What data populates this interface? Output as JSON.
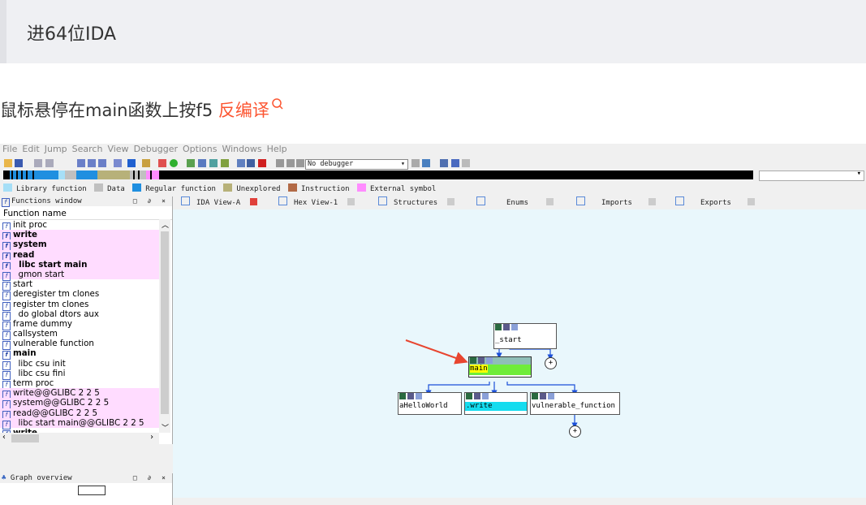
{
  "quote": {
    "text": "进64位IDA"
  },
  "instruction": {
    "text": "鼠标悬停在main函数上按f5 ",
    "link": "反编译"
  },
  "ida": {
    "menu": [
      "File",
      "Edit",
      "Jump",
      "Search",
      "View",
      "Debugger",
      "Options",
      "Windows",
      "Help"
    ],
    "debugger": "No debugger",
    "legend": [
      {
        "label": "Library function",
        "color": "#a6dff7"
      },
      {
        "label": "Data",
        "color": "#c0c0c0"
      },
      {
        "label": "Regular function",
        "color": "#1f8fe0"
      },
      {
        "label": "Unexplored",
        "color": "#b7b179"
      },
      {
        "label": "Instruction",
        "color": "#b26a46"
      },
      {
        "label": "External symbol",
        "color": "#ff8cff"
      }
    ],
    "functions_window": {
      "title": "Functions window",
      "header": "Function name",
      "rows": [
        {
          "name": "init proc",
          "pink": false,
          "bold": false
        },
        {
          "name": "write",
          "pink": true,
          "bold": true
        },
        {
          "name": "system",
          "pink": true,
          "bold": true
        },
        {
          "name": "read",
          "pink": true,
          "bold": true
        },
        {
          "name": "  libc start main",
          "pink": true,
          "bold": true
        },
        {
          "name": "  gmon start",
          "pink": true,
          "bold": false
        },
        {
          "name": "start",
          "pink": false,
          "bold": false
        },
        {
          "name": "deregister tm clones",
          "pink": false,
          "bold": false
        },
        {
          "name": "register tm clones",
          "pink": false,
          "bold": false
        },
        {
          "name": "  do global dtors aux",
          "pink": false,
          "bold": false
        },
        {
          "name": "frame dummy",
          "pink": false,
          "bold": false
        },
        {
          "name": "callsystem",
          "pink": false,
          "bold": false
        },
        {
          "name": "vulnerable function",
          "pink": false,
          "bold": false
        },
        {
          "name": "main",
          "pink": false,
          "bold": true
        },
        {
          "name": "  libc csu init",
          "pink": false,
          "bold": false
        },
        {
          "name": "  libc csu fini",
          "pink": false,
          "bold": false
        },
        {
          "name": "term proc",
          "pink": false,
          "bold": false
        },
        {
          "name": "write@@GLIBC 2 2 5",
          "pink": true,
          "bold": false
        },
        {
          "name": "system@@GLIBC 2 2 5",
          "pink": true,
          "bold": false
        },
        {
          "name": "read@@GLIBC 2 2 5",
          "pink": true,
          "bold": false
        },
        {
          "name": "  libc start main@@GLIBC 2 2 5",
          "pink": true,
          "bold": false
        },
        {
          "name": "write",
          "pink": false,
          "bold": true
        }
      ]
    },
    "graph_overview": {
      "title": "Graph overview"
    },
    "tabs": [
      "IDA View-A",
      "Hex View-1",
      "Structures",
      "Enums",
      "Imports",
      "Exports"
    ],
    "nodes": {
      "start": "_start",
      "main": "main",
      "hello": "aHelloWorld",
      "write": ".write",
      "vuln": "vulnerable_function"
    },
    "plus": "+"
  }
}
